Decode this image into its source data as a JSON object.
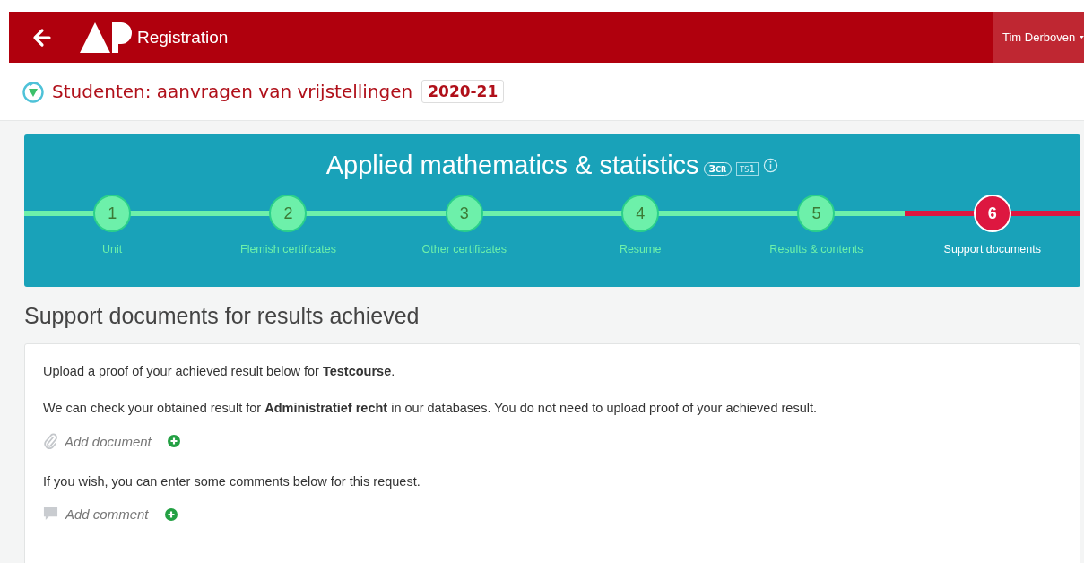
{
  "header": {
    "app_name": "Registration",
    "user_name": "Tim Derboven"
  },
  "page_title": {
    "title": "Studenten: aanvragen van vrijstellingen",
    "year": "2020-21"
  },
  "course": {
    "title": "Applied mathematics & statistics",
    "credits": "3",
    "credits_unit": "CR",
    "term_prefix": "TS",
    "term": "1"
  },
  "steps": [
    {
      "number": "1",
      "label": "Unit",
      "selected": false
    },
    {
      "number": "2",
      "label": "Flemish certificates",
      "selected": false
    },
    {
      "number": "3",
      "label": "Other certificates",
      "selected": false
    },
    {
      "number": "4",
      "label": "Resume",
      "selected": false
    },
    {
      "number": "5",
      "label": "Results & contents",
      "selected": false
    },
    {
      "number": "6",
      "label": "Support documents",
      "selected": true
    }
  ],
  "section_title": "Support documents for results achieved",
  "content": [
    {
      "kind": "text",
      "text": "Upload a proof of your achieved result below for **Testcourse**."
    },
    {
      "kind": "text",
      "text": "We can check your obtained result for **Administratief recht** in our databases. You do not need to upload proof of your achieved result."
    },
    {
      "kind": "document",
      "label": "Add document"
    },
    {
      "kind": "text",
      "text": "If you wish, you can enter some comments below for this request."
    },
    {
      "kind": "comment",
      "label": "Add comment"
    }
  ]
}
